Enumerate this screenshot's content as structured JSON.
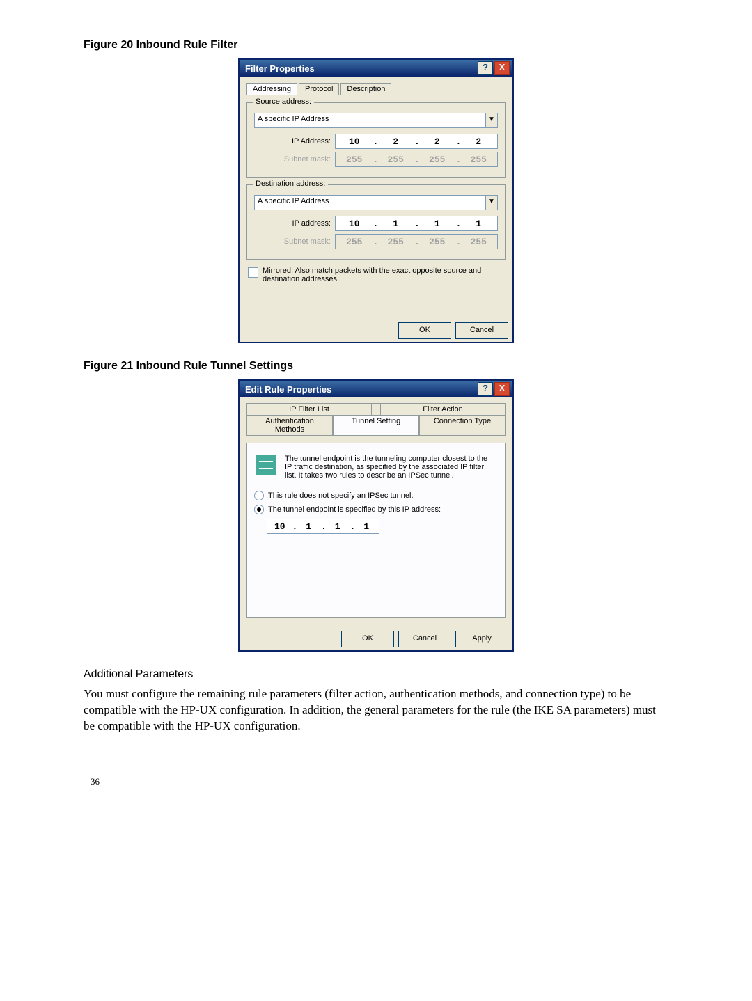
{
  "captions": {
    "fig20": "Figure  20  Inbound Rule Filter",
    "fig21": "Figure  21  Inbound Rule Tunnel Settings"
  },
  "filter": {
    "title": "Filter Properties",
    "help": "?",
    "close": "X",
    "tabs": {
      "addressing": "Addressing",
      "protocol": "Protocol",
      "description": "Description"
    },
    "source": {
      "legend": "Source address:",
      "combo": "A specific IP Address",
      "ip_label": "IP Address:",
      "ip": {
        "o1": "10",
        "o2": "2",
        "o3": "2",
        "o4": "2"
      },
      "mask_label": "Subnet mask:",
      "mask": {
        "o1": "255",
        "o2": "255",
        "o3": "255",
        "o4": "255"
      }
    },
    "dest": {
      "legend": "Destination address:",
      "combo": "A specific IP Address",
      "ip_label": "IP address:",
      "ip": {
        "o1": "10",
        "o2": "1",
        "o3": "1",
        "o4": "1"
      },
      "mask_label": "Subnet mask:",
      "mask": {
        "o1": "255",
        "o2": "255",
        "o3": "255",
        "o4": "255"
      }
    },
    "mirrored": "Mirrored. Also match packets with the exact opposite source and destination addresses.",
    "ok": "OK",
    "cancel": "Cancel"
  },
  "tunnel": {
    "title": "Edit Rule Properties",
    "help": "?",
    "close": "X",
    "tabs_back": {
      "ipfilter": "IP Filter List",
      "action": "Filter Action"
    },
    "tabs_front": {
      "auth": "Authentication Methods",
      "tunnel": "Tunnel Setting",
      "conn": "Connection Type"
    },
    "info": "The tunnel endpoint is the tunneling computer closest to the IP traffic destination, as specified by the associated IP filter list. It takes two rules to describe an IPSec tunnel.",
    "radio_none": "This rule does not specify an IPSec tunnel.",
    "radio_ep": "The tunnel endpoint is specified by this IP address:",
    "ip": {
      "o1": "10",
      "o2": "1",
      "o3": "1",
      "o4": "1"
    },
    "ok": "OK",
    "cancel": "Cancel",
    "apply": "Apply"
  },
  "text": {
    "heading": "Additional Parameters",
    "body": "You must configure the remaining rule parameters (filter action, authentication methods, and connection type) to be compatible with the HP-UX configuration. In addition, the general parameters for the rule (the IKE SA parameters) must be compatible with the HP-UX configuration."
  },
  "page_number": "36",
  "dot": "."
}
